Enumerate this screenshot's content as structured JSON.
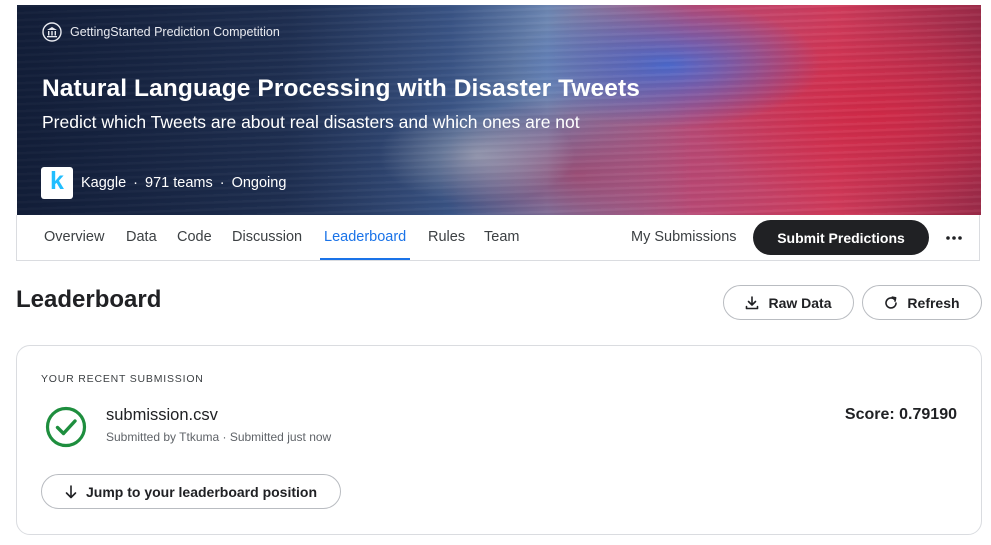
{
  "banner": {
    "competition_type": "GettingStarted Prediction Competition",
    "title": "Natural Language Processing with Disaster Tweets",
    "subtitle": "Predict which Tweets are about real disasters and which ones are not",
    "host": "Kaggle",
    "host_logo_letter": "k",
    "teams": "971 teams",
    "status": "Ongoing",
    "separator": "·"
  },
  "tabs": [
    {
      "label": "Overview"
    },
    {
      "label": "Data"
    },
    {
      "label": "Code"
    },
    {
      "label": "Discussion"
    },
    {
      "label": "Leaderboard",
      "active": true
    },
    {
      "label": "Rules"
    },
    {
      "label": "Team"
    }
  ],
  "nav_actions": {
    "my_submissions": "My Submissions",
    "submit": "Submit Predictions"
  },
  "leaderboard": {
    "title": "Leaderboard",
    "raw_data": "Raw Data",
    "refresh": "Refresh"
  },
  "recent_submission": {
    "label": "YOUR RECENT SUBMISSION",
    "file_name": "submission.csv",
    "meta": "Submitted by Ttkuma · Submitted just now",
    "score_label": "Score:",
    "score_value": "0.79190",
    "jump_button": "Jump to your leaderboard position"
  },
  "colors": {
    "accent": "#1a73e8",
    "success": "#1e8e3e",
    "kaggle_blue": "#20beff",
    "primary_button": "#202124"
  },
  "icons": [
    "bank-icon",
    "kaggle-logo",
    "more-icon",
    "download-icon",
    "refresh-icon",
    "check-circle-icon",
    "arrow-down-icon"
  ]
}
